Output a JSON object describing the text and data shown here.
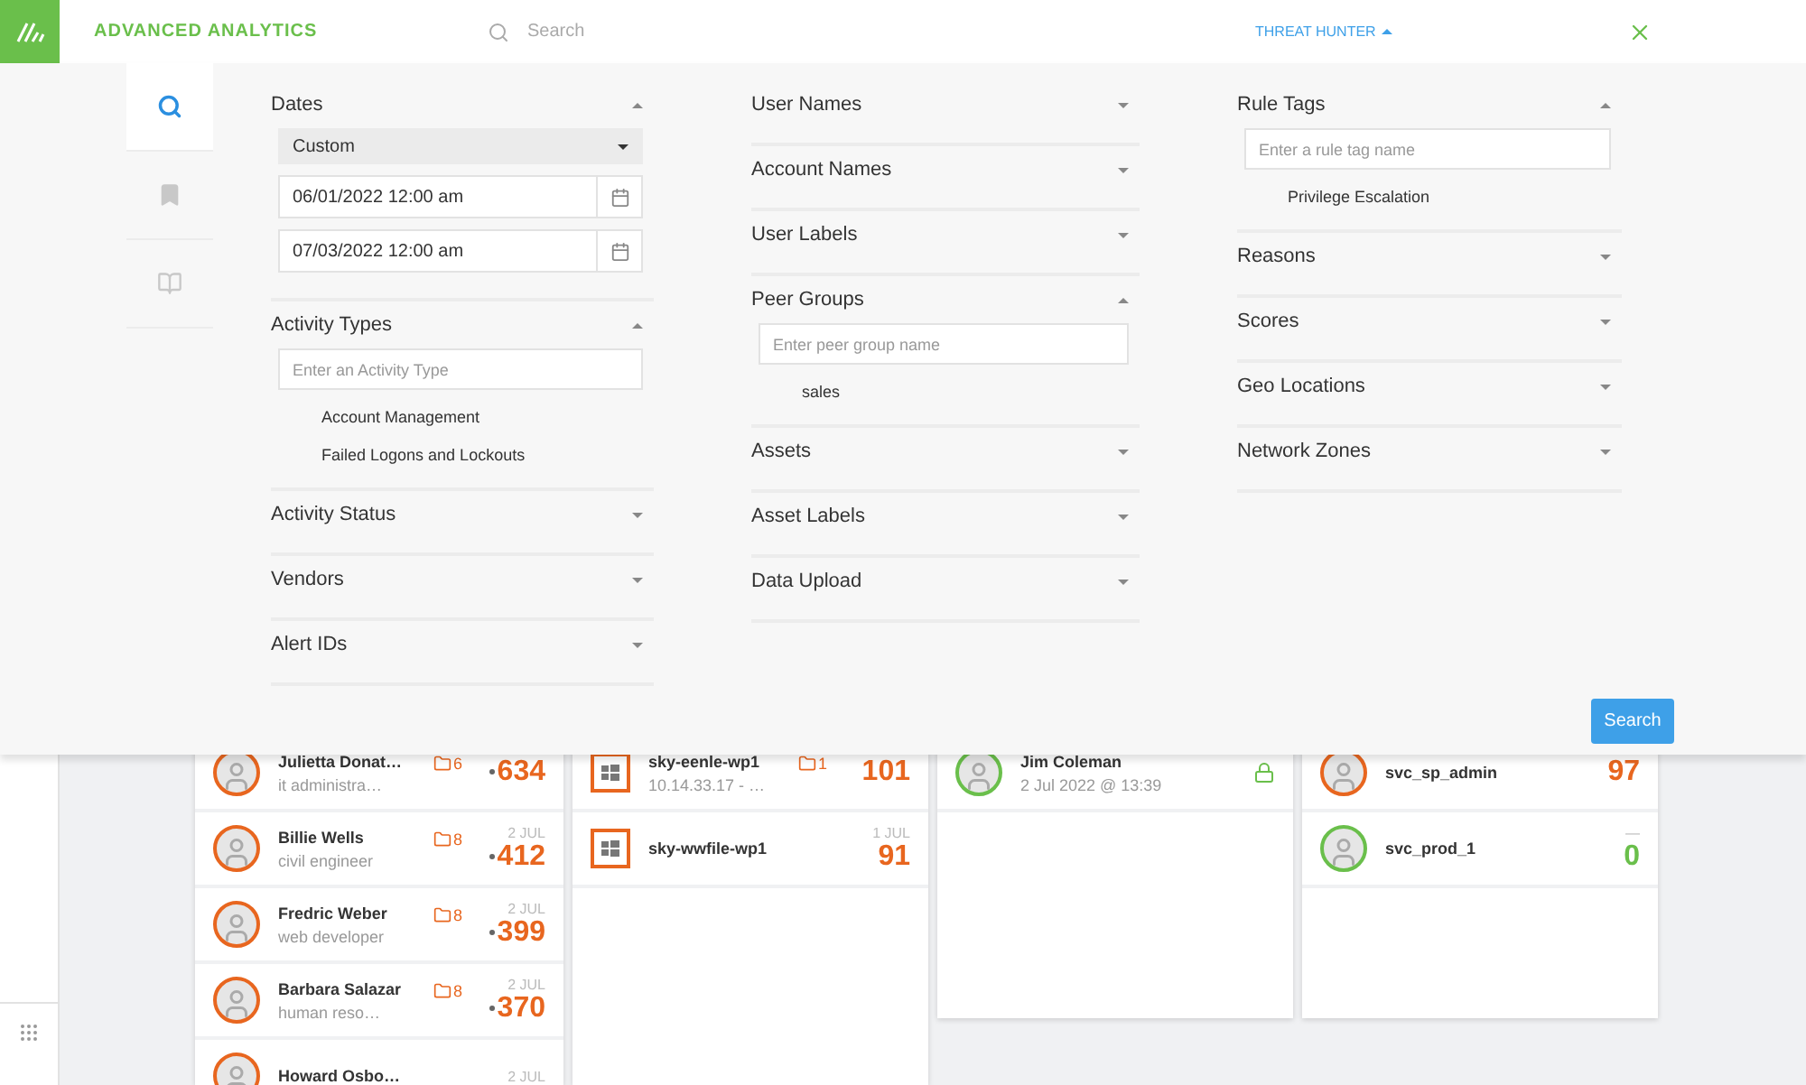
{
  "header": {
    "logo_text": "ADVANCED ANALYTICS",
    "search_placeholder": "Search",
    "menu": {
      "label": "THREAT HUNTER",
      "expanded": true
    }
  },
  "nav_tabs": [
    {
      "selected": true
    },
    {
      "selected": false
    },
    {
      "selected": false
    }
  ],
  "filter_columns": [
    [
      {
        "kind": "dates",
        "title": "Dates",
        "expanded": true,
        "range": "Custom",
        "dates": [
          "06/01/2022 12:00 am",
          "07/03/2022 12:00 am"
        ]
      },
      {
        "kind": "search",
        "title": "Activity Types",
        "expanded": true,
        "placeholder": "Enter an Activity Type",
        "options": [
          "Account Management",
          "Failed Logons and Lockouts"
        ]
      },
      {
        "kind": "plain",
        "title": "Activity Status",
        "expanded": false
      },
      {
        "kind": "plain",
        "title": "Vendors",
        "expanded": false
      },
      {
        "kind": "plain",
        "title": "Alert IDs",
        "expanded": false
      }
    ],
    [
      {
        "kind": "plain",
        "title": "User Names",
        "expanded": false
      },
      {
        "kind": "plain",
        "title": "Account Names",
        "expanded": false
      },
      {
        "kind": "plain",
        "title": "User Labels",
        "expanded": false
      },
      {
        "kind": "search",
        "title": "Peer Groups",
        "expanded": true,
        "placeholder": "Enter peer group name",
        "options": [
          "sales"
        ]
      },
      {
        "kind": "plain",
        "title": "Assets",
        "expanded": false
      },
      {
        "kind": "plain",
        "title": "Asset Labels",
        "expanded": false
      },
      {
        "kind": "plain",
        "title": "Data Upload",
        "expanded": false
      }
    ],
    [
      {
        "kind": "search",
        "title": "Rule Tags",
        "expanded": true,
        "placeholder": "Enter a rule tag name",
        "options": [
          "Privilege Escalation"
        ]
      },
      {
        "kind": "plain",
        "title": "Reasons",
        "expanded": false
      },
      {
        "kind": "plain",
        "title": "Scores",
        "expanded": false
      },
      {
        "kind": "plain",
        "title": "Geo Locations",
        "expanded": false
      },
      {
        "kind": "plain",
        "title": "Network Zones",
        "expanded": false
      }
    ]
  ],
  "search_button": "Search",
  "users": [
    {
      "name": "Julietta Donat…",
      "title": "it administra…",
      "count": "6",
      "score": "634"
    },
    {
      "name": "Billie Wells",
      "title": "civil engineer",
      "count": "8",
      "date": "2 JUL",
      "score": "412"
    },
    {
      "name": "Fredric Weber",
      "title": "web developer",
      "count": "8",
      "date": "2 JUL",
      "score": "399"
    },
    {
      "name": "Barbara Salazar",
      "title": "human reso…",
      "count": "8",
      "date": "2 JUL",
      "score": "370"
    },
    {
      "name": "Howard Osbo…",
      "date": "2 JUL"
    }
  ],
  "assets": [
    {
      "name": "sky-eenle-wp1",
      "subtitle": "10.14.33.17 - …",
      "count": "1",
      "score": "101"
    },
    {
      "name": "sky-wwfile-wp1",
      "date": "1 JUL",
      "score": "91"
    }
  ],
  "sessions": [
    {
      "name": "Jim Coleman",
      "time": "2 Jul 2022 @ 13:39",
      "locked": true
    }
  ],
  "accounts": [
    {
      "name": "svc_sp_admin",
      "score": "97",
      "color": "#e8661f"
    },
    {
      "name": "svc_prod_1",
      "date": "—",
      "score": "0",
      "color": "#6abf4b"
    }
  ]
}
